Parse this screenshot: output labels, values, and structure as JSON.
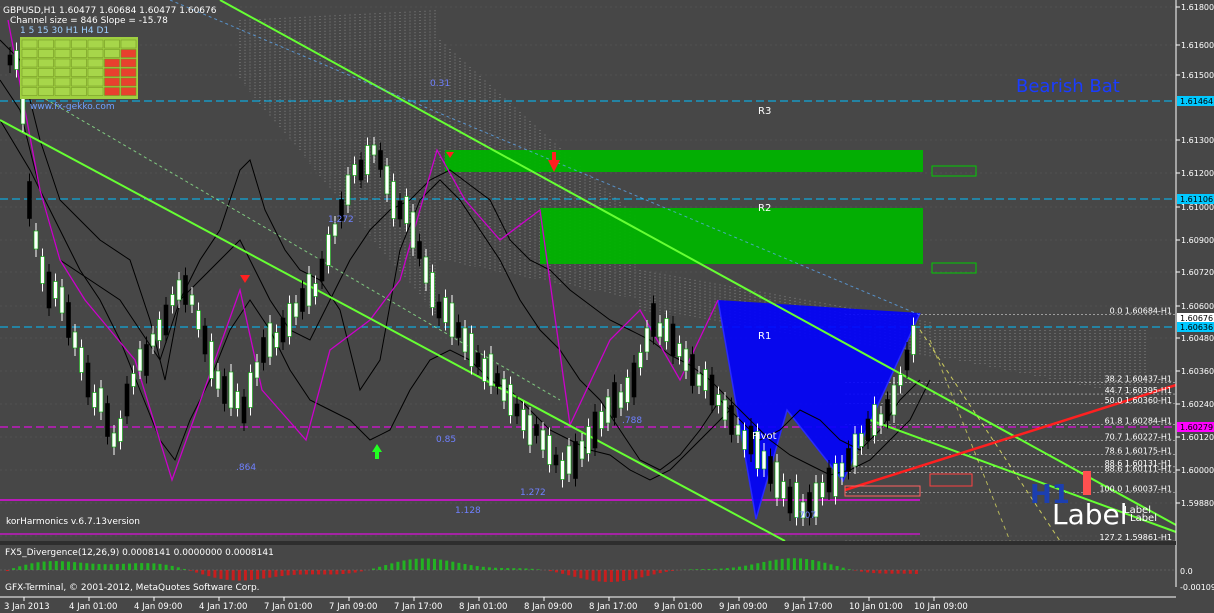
{
  "chart_header": {
    "symbol_line": "GBPUSD,H1  1.60477 1.60684 1.60477 1.60676",
    "channel_info": "Channel size = 846 Slope = -15.78",
    "timeframes": "1  5  15 30  H1  H4  D1",
    "website": "www.fx-gekko.com"
  },
  "indicator_labels": {
    "harmonics": "korHarmonics v.6.7.13version",
    "pattern_name": "Bearish Bat",
    "pivot": "Pivot",
    "r1": "R1",
    "r2": "R2",
    "r3": "R3",
    "watermark": "H1",
    "label_big": "Label",
    "label_small_1": "Label",
    "label_small_2": "Label",
    "fib_ratio_1": "1.272",
    "fib_ratio_2": "1.128",
    "fib_ratio_3": ".788",
    "fib_ratio_4": ".707",
    "fib_ratio_5": ".864",
    "fib_ratio_6": "1.272",
    "fib_ratio_7": "0.31",
    "fib_ratio_8": "0.85"
  },
  "fib_levels": [
    {
      "text": "0.0 1.60684-H1",
      "value": 1.60684
    },
    {
      "text": "38.2 1.60437-H1",
      "value": 1.60437
    },
    {
      "text": "44.7 1.60395-H1",
      "value": 1.60395
    },
    {
      "text": "50.0 1.60360-H1",
      "value": 1.6036
    },
    {
      "text": "61.8 1.60284-H1",
      "value": 1.60284
    },
    {
      "text": "70.7 1.60227-H1",
      "value": 1.60227
    },
    {
      "text": "78.6 1.60175-H1",
      "value": 1.60175
    },
    {
      "text": "88.6 1.60131-H1",
      "value": 1.60131
    },
    {
      "text": "88.6 1.60111-H1",
      "value": 1.60111
    },
    {
      "text": "100.0 1.60037-H1",
      "value": 1.60037
    },
    {
      "text": "127.2 1.59861-H1",
      "value": 1.59861
    }
  ],
  "price_axis": {
    "ticks": [
      "1.61800",
      "1.61600",
      "1.61500",
      "1.61300",
      "1.61200",
      "1.61000",
      "1.60900",
      "1.60720",
      "1.60600",
      "1.60480",
      "1.60360",
      "1.60240",
      "1.60120",
      "1.60000",
      "1.59880"
    ],
    "highlighted": [
      {
        "text": "1.61464",
        "color": "#00c8ff"
      },
      {
        "text": "1.61106",
        "color": "#00c8ff"
      },
      {
        "text": "1.60676",
        "color": "#ffffff"
      },
      {
        "text": "1.60636",
        "color": "#00c8ff"
      },
      {
        "text": "1.60279",
        "color": "#ff00ff"
      }
    ]
  },
  "time_axis": [
    "3 Jan 2013",
    "4 Jan 01:00",
    "4 Jan 09:00",
    "4 Jan 17:00",
    "7 Jan 01:00",
    "7 Jan 09:00",
    "7 Jan 17:00",
    "8 Jan 01:00",
    "8 Jan 09:00",
    "8 Jan 17:00",
    "9 Jan 01:00",
    "9 Jan 09:00",
    "9 Jan 17:00",
    "10 Jan 01:00",
    "10 Jan 09:00"
  ],
  "sub_window": {
    "title": "FX5_Divergence(12,26,9) 0.0008141 0.0000000 0.0008141",
    "ticks": [
      "0.0",
      "-0.00109"
    ],
    "copyright": "GFX-Terminal, © 2001-2012, MetaQuotes Software Corp."
  },
  "colors": {
    "background": "#474747",
    "bull_candle": "#ffffff",
    "bear_candle": "#000000",
    "channel": "#66ff33",
    "supply_zone": "#00cc00",
    "bat_pattern": "#0000ff",
    "pivot_line": "#00bfff",
    "magenta_line": "#ff00ff",
    "trend_red": "#ff0000"
  }
}
